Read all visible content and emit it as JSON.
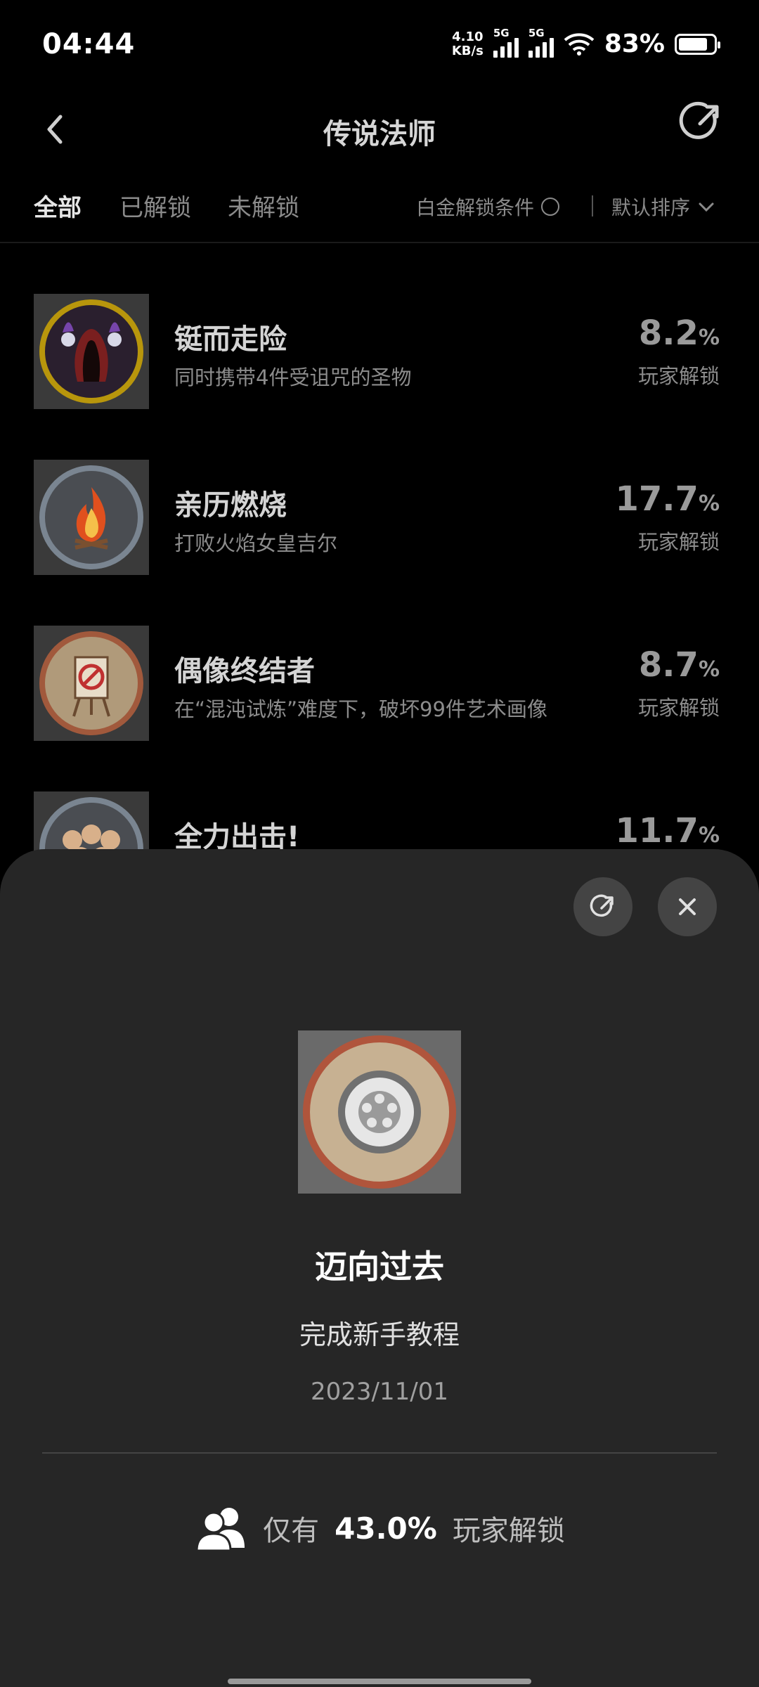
{
  "status": {
    "time": "04:44",
    "net_speed_top": "4.10",
    "net_speed_bottom": "KB/s",
    "sim1": "5G",
    "sim2": "5G",
    "battery": "83%",
    "battery_level": 0.83
  },
  "header": {
    "title": "传说法师",
    "back_icon": "chevron-left-icon",
    "share_icon": "share-icon"
  },
  "tabs": [
    {
      "label": "全部",
      "active": true
    },
    {
      "label": "已解锁",
      "active": false
    },
    {
      "label": "未解锁",
      "active": false
    }
  ],
  "filter": {
    "platinum_label": "白金解锁条件",
    "sort_label": "默认排序"
  },
  "achievements": [
    {
      "name": "铤而走险",
      "desc": "同时携带4件受诅咒的圣物",
      "pct": "8.2",
      "unit": "%",
      "pct_label": "玩家解锁",
      "icon": "cursed-mage-icon",
      "ring": "#b8960c"
    },
    {
      "name": "亲历燃烧",
      "desc": "打败火焰女皇吉尔",
      "pct": "17.7",
      "unit": "%",
      "pct_label": "玩家解锁",
      "icon": "flame-icon",
      "ring": "#7a8591"
    },
    {
      "name": "偶像终结者",
      "desc": "在“混沌试炼”难度下，破坏99件艺术画像",
      "pct": "8.7",
      "unit": "%",
      "pct_label": "玩家解锁",
      "icon": "easel-icon",
      "ring": "#a1593c"
    },
    {
      "name": "全力出击!",
      "desc": "",
      "pct": "11.7",
      "unit": "%",
      "pct_label": "",
      "icon": "fists-icon",
      "ring": "#7a8591"
    }
  ],
  "sheet": {
    "title": "迈向过去",
    "desc": "完成新手教程",
    "date": "2023/11/01",
    "stats_prefix": "仅有",
    "stats_value": "43.0%",
    "stats_suffix": "玩家解锁",
    "badge_icon": "wheel-icon",
    "users_icon": "users-icon",
    "share_icon": "share-icon",
    "close_icon": "close-icon"
  }
}
